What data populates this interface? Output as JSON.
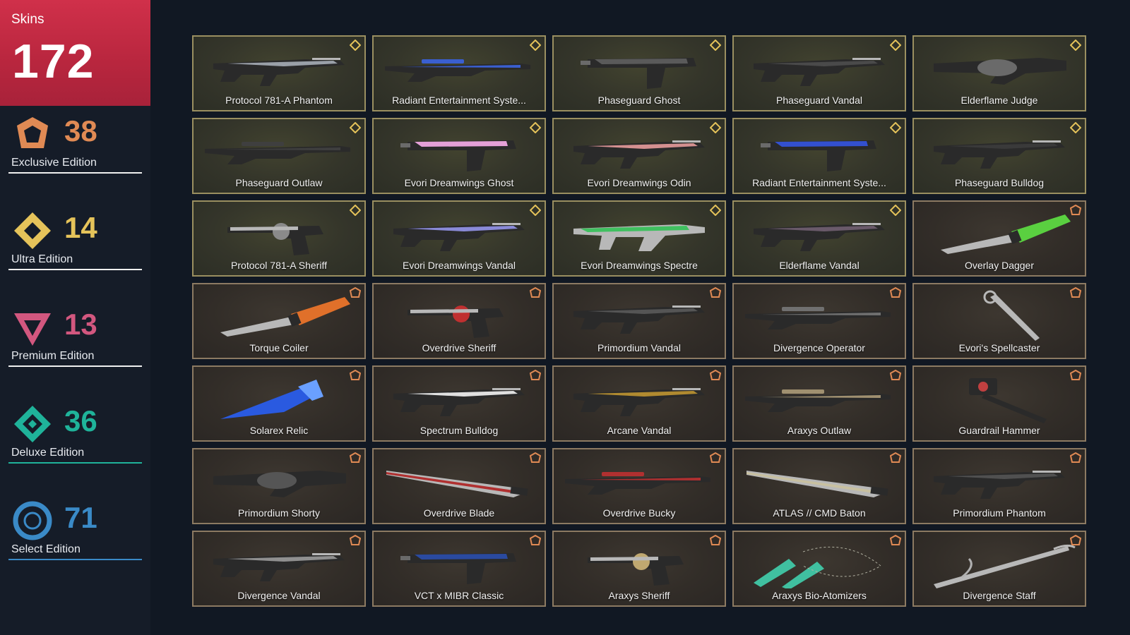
{
  "header": {
    "label": "Skins",
    "total": "172"
  },
  "tiers": [
    {
      "id": "exclusive",
      "count": "38",
      "name": "Exclusive Edition",
      "color": "#e08a54",
      "line": "#f0f0f0",
      "icon": "exclusive-tier-icon"
    },
    {
      "id": "ultra",
      "count": "14",
      "name": "Ultra Edition",
      "color": "#e5c35a",
      "line": "#f0f0f0",
      "icon": "ultra-tier-icon"
    },
    {
      "id": "premium",
      "count": "13",
      "name": "Premium Edition",
      "color": "#d2577f",
      "line": "#f0f0f0",
      "icon": "premium-tier-icon"
    },
    {
      "id": "deluxe",
      "count": "36",
      "name": "Deluxe Edition",
      "color": "#1fb39a",
      "line": "#1fb39a",
      "icon": "deluxe-tier-icon"
    },
    {
      "id": "select",
      "count": "71",
      "name": "Select Edition",
      "color": "#3a8ac7",
      "line": "#3a8ac7",
      "icon": "select-tier-icon"
    }
  ],
  "skins": [
    {
      "name": "Protocol 781-A Phantom",
      "tier": "ultra",
      "shape": "rifle",
      "accent": "#9aa0a8"
    },
    {
      "name": "Radiant Entertainment Syste...",
      "tier": "ultra",
      "shape": "sniper",
      "accent": "#3a5fd0"
    },
    {
      "name": "Phaseguard Ghost",
      "tier": "ultra",
      "shape": "pistol",
      "accent": "#5a5a5a"
    },
    {
      "name": "Phaseguard Vandal",
      "tier": "ultra",
      "shape": "rifle",
      "accent": "#4a4a4a"
    },
    {
      "name": "Elderflame Judge",
      "tier": "ultra",
      "shape": "shotgun",
      "accent": "#6a6a6a"
    },
    {
      "name": "Phaseguard Outlaw",
      "tier": "ultra",
      "shape": "sniper",
      "accent": "#3f3f3f"
    },
    {
      "name": "Evori Dreamwings Ghost",
      "tier": "ultra",
      "shape": "pistol",
      "accent": "#e4a0d8"
    },
    {
      "name": "Evori Dreamwings Odin",
      "tier": "ultra",
      "shape": "rifle",
      "accent": "#d49090"
    },
    {
      "name": "Radiant Entertainment Syste...",
      "tier": "ultra",
      "shape": "pistol",
      "accent": "#3350d0"
    },
    {
      "name": "Phaseguard Bulldog",
      "tier": "ultra",
      "shape": "rifle",
      "accent": "#3a3a3a"
    },
    {
      "name": "Protocol 781-A Sheriff",
      "tier": "ultra",
      "shape": "revolver",
      "accent": "#8a8a8a"
    },
    {
      "name": "Evori Dreamwings Vandal",
      "tier": "ultra",
      "shape": "rifle",
      "accent": "#8a8ad8"
    },
    {
      "name": "Evori Dreamwings Spectre",
      "tier": "ultra",
      "shape": "smg",
      "accent": "#40c060"
    },
    {
      "name": "Elderflame Vandal",
      "tier": "ultra",
      "shape": "rifle",
      "accent": "#6a5a6a"
    },
    {
      "name": "Overlay Dagger",
      "tier": "exclusive",
      "shape": "knife",
      "accent": "#5ad040"
    },
    {
      "name": "Torque Coiler",
      "tier": "exclusive",
      "shape": "knife",
      "accent": "#e0702a"
    },
    {
      "name": "Overdrive Sheriff",
      "tier": "exclusive",
      "shape": "revolver",
      "accent": "#c03030"
    },
    {
      "name": "Primordium Vandal",
      "tier": "exclusive",
      "shape": "rifle",
      "accent": "#555"
    },
    {
      "name": "Divergence Operator",
      "tier": "exclusive",
      "shape": "sniper",
      "accent": "#707070"
    },
    {
      "name": "Evori's Spellcaster",
      "tier": "exclusive",
      "shape": "wand",
      "accent": "#c0c0c0"
    },
    {
      "name": "Solarex Relic",
      "tier": "exclusive",
      "shape": "blade",
      "accent": "#2a5ae0"
    },
    {
      "name": "Spectrum Bulldog",
      "tier": "exclusive",
      "shape": "rifle",
      "accent": "#e0e0e0"
    },
    {
      "name": "Arcane Vandal",
      "tier": "exclusive",
      "shape": "rifle",
      "accent": "#b08a30"
    },
    {
      "name": "Araxys Outlaw",
      "tier": "exclusive",
      "shape": "sniper",
      "accent": "#a09070"
    },
    {
      "name": "Guardrail Hammer",
      "tier": "exclusive",
      "shape": "hammer",
      "accent": "#c04040"
    },
    {
      "name": "Primordium Shorty",
      "tier": "exclusive",
      "shape": "shotgun",
      "accent": "#555"
    },
    {
      "name": "Overdrive Blade",
      "tier": "exclusive",
      "shape": "sword",
      "accent": "#b03030"
    },
    {
      "name": "Overdrive Bucky",
      "tier": "exclusive",
      "shape": "sniper",
      "accent": "#b03030"
    },
    {
      "name": "ATLAS // CMD Baton",
      "tier": "exclusive",
      "shape": "sword",
      "accent": "#c8c0a0"
    },
    {
      "name": "Primordium Phantom",
      "tier": "exclusive",
      "shape": "rifle",
      "accent": "#505050"
    },
    {
      "name": "Divergence Vandal",
      "tier": "exclusive",
      "shape": "rifle",
      "accent": "#909090"
    },
    {
      "name": "VCT x MIBR Classic",
      "tier": "exclusive",
      "shape": "pistol",
      "accent": "#2a4aa0"
    },
    {
      "name": "Araxys Sheriff",
      "tier": "exclusive",
      "shape": "revolver",
      "accent": "#c0a870"
    },
    {
      "name": "Araxys Bio-Atomizers",
      "tier": "exclusive",
      "shape": "claws",
      "accent": "#40c0a0"
    },
    {
      "name": "Divergence Staff",
      "tier": "exclusive",
      "shape": "staff",
      "accent": "#b0b0b0"
    }
  ]
}
